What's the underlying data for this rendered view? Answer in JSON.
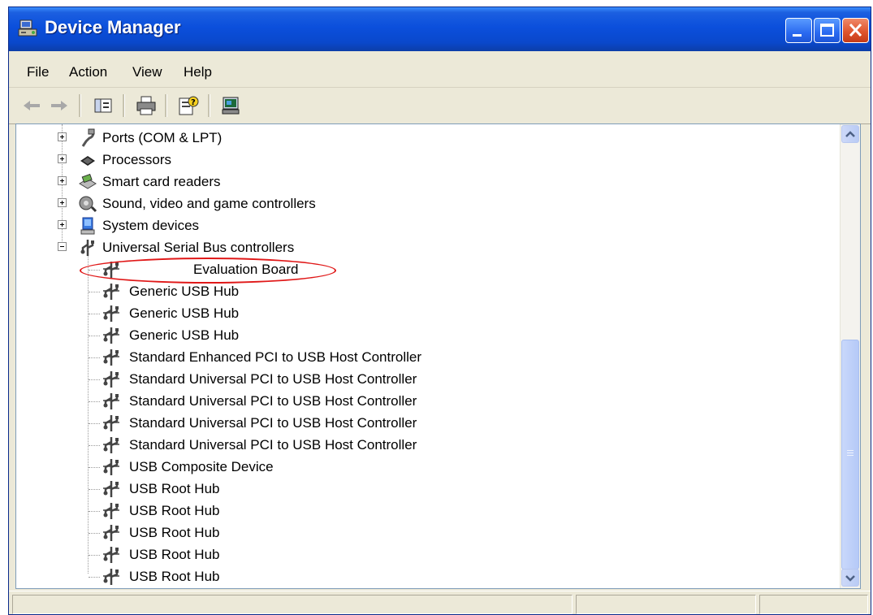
{
  "window": {
    "title": "Device Manager",
    "title_color": "#0b4fdc",
    "close_color": "#e0552e"
  },
  "menu": [
    "File",
    "Action",
    "View",
    "Help"
  ],
  "toolbar": {
    "icons": [
      "back-arrow-icon",
      "forward-arrow-icon",
      "show-hide-console-tree-icon",
      "print-icon",
      "properties-help-icon",
      "scan-hardware-icon"
    ]
  },
  "tree": {
    "categories": [
      {
        "label": "Ports (COM & LPT)",
        "icon": "port-icon",
        "expanded": false
      },
      {
        "label": "Processors",
        "icon": "processor-icon",
        "expanded": false
      },
      {
        "label": "Smart card readers",
        "icon": "smart-card-icon",
        "expanded": false
      },
      {
        "label": "Sound, video and game controllers",
        "icon": "sound-icon",
        "expanded": false
      },
      {
        "label": "System devices",
        "icon": "system-icon",
        "expanded": false
      },
      {
        "label": "Universal Serial Bus controllers",
        "icon": "usb-icon",
        "expanded": true
      }
    ],
    "usb_devices": [
      "Evaluation Board",
      "Generic USB Hub",
      "Generic USB Hub",
      "Generic USB Hub",
      "Standard Enhanced PCI to USB Host Controller",
      "Standard Universal PCI to USB Host Controller",
      "Standard Universal PCI to USB Host Controller",
      "Standard Universal PCI to USB Host Controller",
      "Standard Universal PCI to USB Host Controller",
      "USB Composite Device",
      "USB Root Hub",
      "USB Root Hub",
      "USB Root Hub",
      "USB Root Hub",
      "USB Root Hub"
    ],
    "highlight_color": "#e01818"
  }
}
